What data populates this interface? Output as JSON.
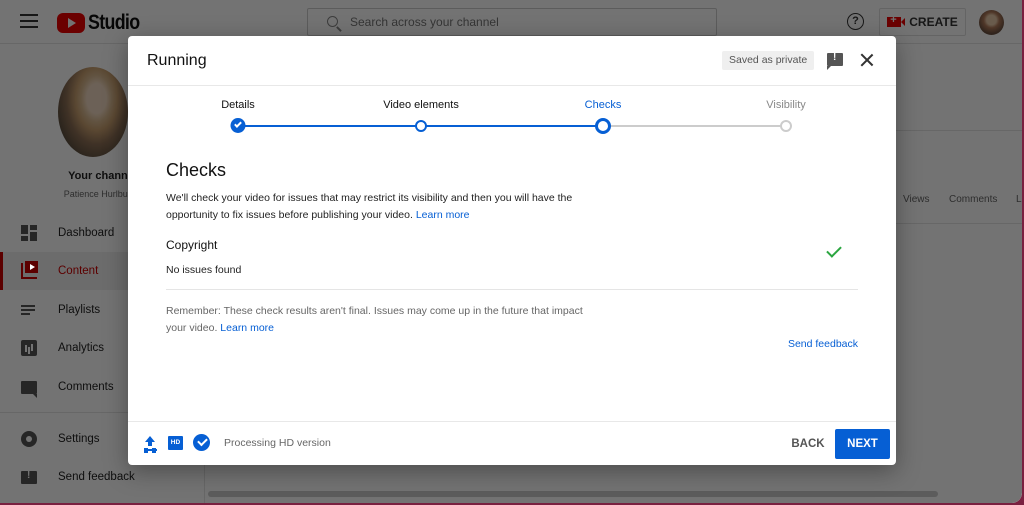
{
  "topbar": {
    "logo_text": "Studio",
    "search_placeholder": "Search across your channel",
    "help_glyph": "?",
    "create_label": "CREATE"
  },
  "sidebar": {
    "channel_title": "Your channel",
    "channel_owner": "Patience Hurlburt-L",
    "items": [
      {
        "label": "Dashboard",
        "icon": "dashboard-icon",
        "active": false
      },
      {
        "label": "Content",
        "icon": "content-icon",
        "active": true
      },
      {
        "label": "Playlists",
        "icon": "playlists-icon",
        "active": false
      },
      {
        "label": "Analytics",
        "icon": "analytics-icon",
        "active": false
      },
      {
        "label": "Comments",
        "icon": "comments-icon",
        "active": false
      },
      {
        "label": "Settings",
        "icon": "settings-icon",
        "active": false
      },
      {
        "label": "Send feedback",
        "icon": "feedback-icon",
        "active": false
      }
    ]
  },
  "background_table": {
    "columns": [
      "Views",
      "Comments",
      "Li"
    ]
  },
  "dialog": {
    "title": "Running",
    "saved_badge": "Saved as private",
    "feedback_glyph": "!",
    "steps": [
      {
        "label": "Details",
        "state": "done"
      },
      {
        "label": "Video elements",
        "state": "visited"
      },
      {
        "label": "Checks",
        "state": "current"
      },
      {
        "label": "Visibility",
        "state": "pending"
      }
    ],
    "colors": {
      "accent": "#065fd4",
      "pending": "#cccccc",
      "success": "#2ba640"
    },
    "section_title": "Checks",
    "section_desc": "We'll check your video for issues that may restrict its visibility and then you will have the opportunity to fix issues before publishing your video.",
    "learn_more": "Learn more",
    "copyright_title": "Copyright",
    "copyright_status": "No issues found",
    "remember_text": "Remember: These check results aren't final. Issues may come up in the future that impact your video.",
    "remember_link": "Learn more",
    "send_feedback": "Send feedback",
    "footer": {
      "hd_badge": "HD",
      "processing_text": "Processing HD version",
      "back_label": "BACK",
      "next_label": "NEXT"
    }
  }
}
